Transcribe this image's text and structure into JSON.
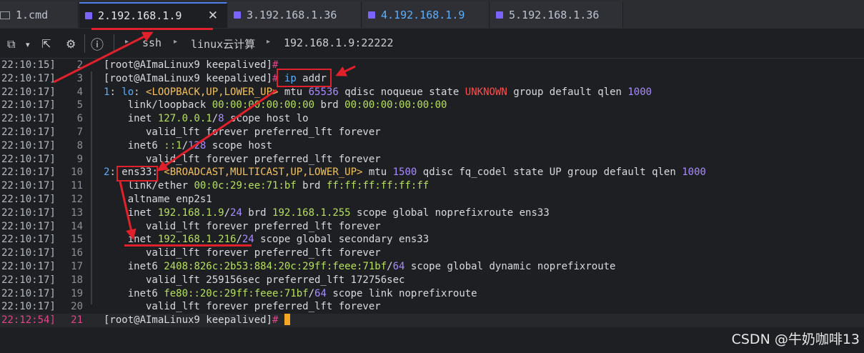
{
  "tabs": [
    {
      "label": "1.cmd",
      "active": false
    },
    {
      "label": "2.192.168.1.9",
      "active": true
    },
    {
      "label": "3.192.168.1.36",
      "active": false
    },
    {
      "label": "4.192.168.1.9",
      "active": false
    },
    {
      "label": "5.192.168.1.36",
      "active": false
    }
  ],
  "toolbar": {
    "breadcrumb": [
      "ssh",
      "linux云计算",
      "192.168.1.9:22222"
    ]
  },
  "terminal": {
    "lines": [
      {
        "ts": "22:10:15]",
        "n": "2",
        "segs": [
          [
            "#d7dae0",
            "[root@AImaLinux9 keepalived]"
          ],
          [
            "#e0468a",
            "#"
          ]
        ]
      },
      {
        "ts": "22:10:17]",
        "n": "3",
        "segs": [
          [
            "#d7dae0",
            "[root@AImaLinux9 keepalived]"
          ],
          [
            "#e0468a",
            "#"
          ],
          [
            "#d7dae0",
            " "
          ],
          [
            "#5ab0ff",
            "ip"
          ],
          [
            "#d7dae0",
            " addr"
          ]
        ]
      },
      {
        "ts": "22:10:17]",
        "n": "4",
        "segs": [
          [
            "#5ab0ff",
            "1"
          ],
          [
            "#d7dae0",
            ": "
          ],
          [
            "#5ab0ff",
            "lo"
          ],
          [
            "#d7dae0",
            ": "
          ],
          [
            "#f5c15a",
            "<LOOPBACK,UP,LOWER_UP>"
          ],
          [
            "#d7dae0",
            " mtu "
          ],
          [
            "#a88bff",
            "65536"
          ],
          [
            "#d7dae0",
            " qdisc noqueue state "
          ],
          [
            "#ff4d4d",
            "UNKNOWN"
          ],
          [
            "#d7dae0",
            " group default qlen "
          ],
          [
            "#a88bff",
            "1000"
          ]
        ]
      },
      {
        "ts": "22:10:17]",
        "n": "5",
        "segs": [
          [
            "#d7dae0",
            "    link/loopback "
          ],
          [
            "#b5e05a",
            "00:00:00:00:00:00"
          ],
          [
            "#d7dae0",
            " brd "
          ],
          [
            "#b5e05a",
            "00:00:00:00:00:00"
          ]
        ]
      },
      {
        "ts": "22:10:17]",
        "n": "6",
        "segs": [
          [
            "#d7dae0",
            "    inet "
          ],
          [
            "#b5e05a",
            "127.0.0.1"
          ],
          [
            "#d7dae0",
            "/"
          ],
          [
            "#a88bff",
            "8"
          ],
          [
            "#d7dae0",
            " scope host lo"
          ]
        ]
      },
      {
        "ts": "22:10:17]",
        "n": "7",
        "segs": [
          [
            "#d7dae0",
            "       valid_lft forever preferred_lft forever"
          ]
        ]
      },
      {
        "ts": "22:10:17]",
        "n": "8",
        "segs": [
          [
            "#d7dae0",
            "    inet6 "
          ],
          [
            "#b5e05a",
            "::1"
          ],
          [
            "#d7dae0",
            "/"
          ],
          [
            "#a88bff",
            "128"
          ],
          [
            "#d7dae0",
            " scope host"
          ]
        ]
      },
      {
        "ts": "22:10:17]",
        "n": "9",
        "segs": [
          [
            "#d7dae0",
            "       valid_lft forever preferred_lft forever"
          ]
        ]
      },
      {
        "ts": "22:10:17]",
        "n": "10",
        "segs": [
          [
            "#5ab0ff",
            "2"
          ],
          [
            "#d7dae0",
            ": "
          ],
          [
            "#d7dae0",
            "ens33"
          ],
          [
            "#d7dae0",
            ": "
          ],
          [
            "#f5c15a",
            "<BROADCAST,MULTICAST,UP,LOWER_UP>"
          ],
          [
            "#d7dae0",
            " mtu "
          ],
          [
            "#a88bff",
            "1500"
          ],
          [
            "#d7dae0",
            " qdisc fq_codel state UP group default qlen "
          ],
          [
            "#a88bff",
            "1000"
          ]
        ]
      },
      {
        "ts": "22:10:17]",
        "n": "11",
        "segs": [
          [
            "#d7dae0",
            "    link/ether "
          ],
          [
            "#b5e05a",
            "00:0c:29:ee:71:bf"
          ],
          [
            "#d7dae0",
            " brd "
          ],
          [
            "#b5e05a",
            "ff:ff:ff:ff:ff:ff"
          ]
        ]
      },
      {
        "ts": "22:10:17]",
        "n": "12",
        "segs": [
          [
            "#d7dae0",
            "    altname enp2s1"
          ]
        ]
      },
      {
        "ts": "22:10:17]",
        "n": "13",
        "segs": [
          [
            "#d7dae0",
            "    inet "
          ],
          [
            "#b5e05a",
            "192.168.1.9"
          ],
          [
            "#d7dae0",
            "/"
          ],
          [
            "#a88bff",
            "24"
          ],
          [
            "#d7dae0",
            " brd "
          ],
          [
            "#b5e05a",
            "192.168.1.255"
          ],
          [
            "#d7dae0",
            " scope global noprefixroute ens33"
          ]
        ]
      },
      {
        "ts": "22:10:17]",
        "n": "14",
        "segs": [
          [
            "#d7dae0",
            "       valid_lft forever preferred_lft forever"
          ]
        ]
      },
      {
        "ts": "22:10:17]",
        "n": "15",
        "segs": [
          [
            "#d7dae0",
            "    inet "
          ],
          [
            "#b5e05a",
            "192.168.1.216"
          ],
          [
            "#d7dae0",
            "/"
          ],
          [
            "#a88bff",
            "24"
          ],
          [
            "#d7dae0",
            " scope global secondary ens33"
          ]
        ]
      },
      {
        "ts": "22:10:17]",
        "n": "16",
        "segs": [
          [
            "#d7dae0",
            "       valid_lft forever preferred_lft forever"
          ]
        ]
      },
      {
        "ts": "22:10:17]",
        "n": "17",
        "segs": [
          [
            "#d7dae0",
            "    inet6 "
          ],
          [
            "#b5e05a",
            "2408:826c:2b53:884:20c:29ff:feee:71bf"
          ],
          [
            "#d7dae0",
            "/"
          ],
          [
            "#a88bff",
            "64"
          ],
          [
            "#d7dae0",
            " scope global dynamic noprefixroute"
          ]
        ]
      },
      {
        "ts": "22:10:17]",
        "n": "18",
        "segs": [
          [
            "#d7dae0",
            "       valid_lft 259156sec preferred_lft 172756sec"
          ]
        ]
      },
      {
        "ts": "22:10:17]",
        "n": "19",
        "segs": [
          [
            "#d7dae0",
            "    inet6 "
          ],
          [
            "#b5e05a",
            "fe80::20c:29ff:feee:71bf"
          ],
          [
            "#d7dae0",
            "/"
          ],
          [
            "#a88bff",
            "64"
          ],
          [
            "#d7dae0",
            " scope link noprefixroute"
          ]
        ]
      },
      {
        "ts": "22:10:17]",
        "n": "20",
        "segs": [
          [
            "#d7dae0",
            "       valid_lft forever preferred_lft forever"
          ]
        ]
      },
      {
        "ts": "22:12:54]",
        "n": "21",
        "segs": [
          [
            "#d7dae0",
            "[root@AImaLinux9 keepalived]"
          ],
          [
            "#e0468a",
            "#"
          ],
          [
            "#d7dae0",
            " "
          ]
        ],
        "current": true
      }
    ]
  },
  "watermark": "CSDN @牛奶咖啡13"
}
